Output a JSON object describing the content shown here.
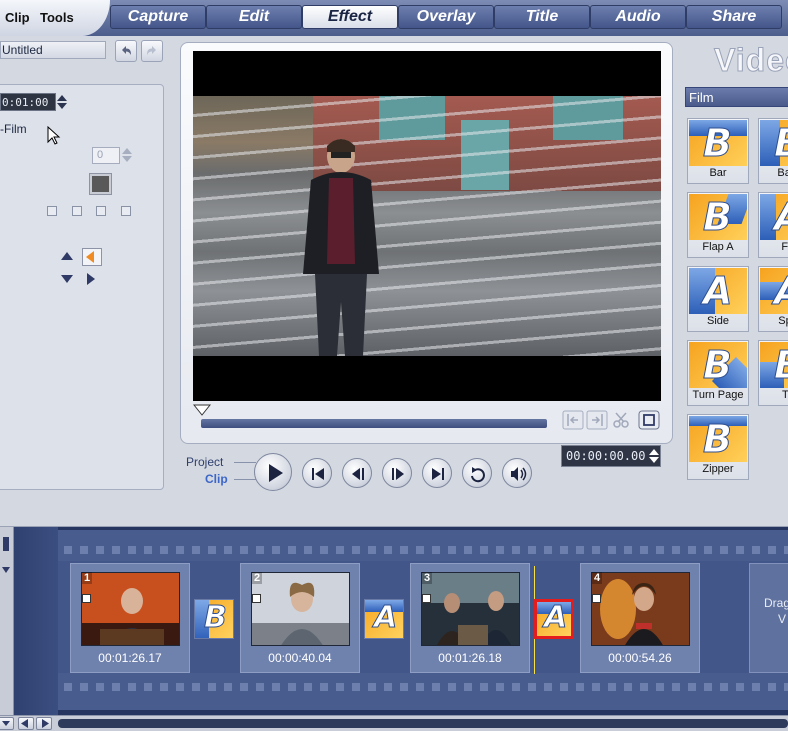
{
  "menu": {
    "clip": "Clip",
    "tools": "Tools"
  },
  "tabs": [
    {
      "label": "Capture"
    },
    {
      "label": "Edit"
    },
    {
      "label": "Effect",
      "active": true
    },
    {
      "label": "Overlay"
    },
    {
      "label": "Title"
    },
    {
      "label": "Audio"
    },
    {
      "label": "Share"
    }
  ],
  "options": {
    "project_name": "Untitled",
    "duration": "0:01:00",
    "effect_name": "-Film",
    "border_value": "0",
    "border_color": "#595959"
  },
  "preview": {
    "project_label": "Project",
    "clip_label": "Clip",
    "timecode": "00:00:00.00"
  },
  "library": {
    "title": "Video",
    "category": "Film",
    "effects": [
      {
        "label": "Bar"
      },
      {
        "label": "Barn"
      },
      {
        "label": "Flap A"
      },
      {
        "label": "Fla"
      },
      {
        "label": "Side"
      },
      {
        "label": "Split"
      },
      {
        "label": "Turn Page"
      },
      {
        "label": "Tw"
      },
      {
        "label": "Zipper"
      }
    ]
  },
  "timeline": {
    "clips": [
      {
        "num": "1",
        "duration": "00:01:26.17"
      },
      {
        "num": "2",
        "duration": "00:00:40.04"
      },
      {
        "num": "3",
        "duration": "00:01:26.18"
      },
      {
        "num": "4",
        "duration": "00:00:54.26"
      }
    ],
    "drag_hint_line1": "Drag",
    "drag_hint_line2": "V"
  },
  "colors": {
    "accent": "#4a5a8b",
    "selected_transition": "#e31d1d",
    "effect_orange": "#f6a31f",
    "effect_blue": "#2d5fb8"
  }
}
